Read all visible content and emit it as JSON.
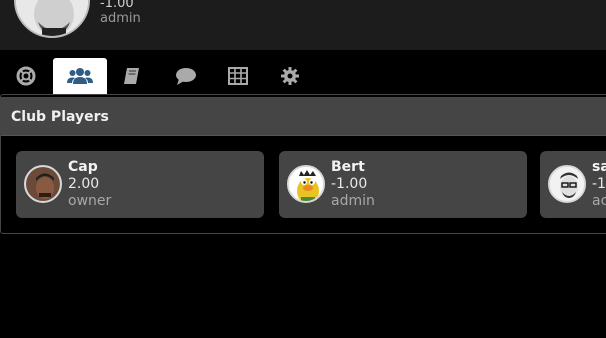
{
  "current_user": {
    "score": "-1.00",
    "role": "admin"
  },
  "tabs": [
    {
      "icon": "lifebuoy-icon",
      "active": false
    },
    {
      "icon": "users-icon",
      "active": true
    },
    {
      "icon": "book-icon",
      "active": false
    },
    {
      "icon": "chat-bubble-icon",
      "active": false
    },
    {
      "icon": "table-grid-icon",
      "active": false
    },
    {
      "icon": "gear-icon",
      "active": false
    }
  ],
  "panel": {
    "title": "Club Players"
  },
  "players": [
    {
      "name": "Cap",
      "score": "2.00",
      "role": "owner"
    },
    {
      "name": "Bert",
      "score": "-1.00",
      "role": "admin"
    },
    {
      "name": "sa",
      "score": "-1",
      "role": "ac"
    }
  ],
  "colors": {
    "background": "#000000",
    "topbar": "#1c1c1c",
    "card": "#454545",
    "active_tab": "#ffffff"
  }
}
